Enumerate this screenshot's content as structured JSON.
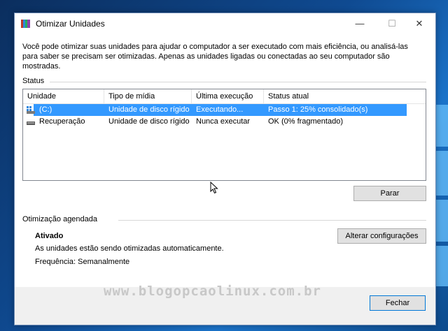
{
  "window": {
    "title": "Otimizar Unidades",
    "controls": {
      "minimize": "—",
      "maximize": "☐",
      "close": "✕"
    }
  },
  "description": "Você pode otimizar suas unidades para ajudar o computador a ser executado com mais eficiência, ou analisá-las para saber se precisam ser otimizadas. Apenas as unidades ligadas ou conectadas ao seu computador são mostradas.",
  "status": {
    "label": "Status",
    "columns": [
      "Unidade",
      "Tipo de mídia",
      "Última execução",
      "Status atual"
    ],
    "rows": [
      {
        "drive": "(C:)",
        "media": "Unidade de disco rígido",
        "last_run": "Executando...",
        "status": "Passo 1: 25% consolidado(s)",
        "selected": true,
        "icon": "system-drive-icon"
      },
      {
        "drive": "Recuperação",
        "media": "Unidade de disco rígido",
        "last_run": "Nunca executar",
        "status": "OK (0% fragmentado)",
        "selected": false,
        "icon": "drive-icon"
      }
    ],
    "stop_button": "Parar"
  },
  "schedule": {
    "label": "Otimização agendada",
    "state": "Ativado",
    "detail": "As unidades estão sendo otimizadas automaticamente.",
    "frequency": "Frequência: Semanalmente",
    "change_button": "Alterar configurações"
  },
  "footer": {
    "close_button": "Fechar",
    "watermark": "www.blogopcaolinux.com.br"
  },
  "colors": {
    "selection": "#3399ff",
    "button_bg": "#e1e1e1",
    "footer_bg": "#f0f0f0",
    "desktop": "#0f4a91"
  }
}
